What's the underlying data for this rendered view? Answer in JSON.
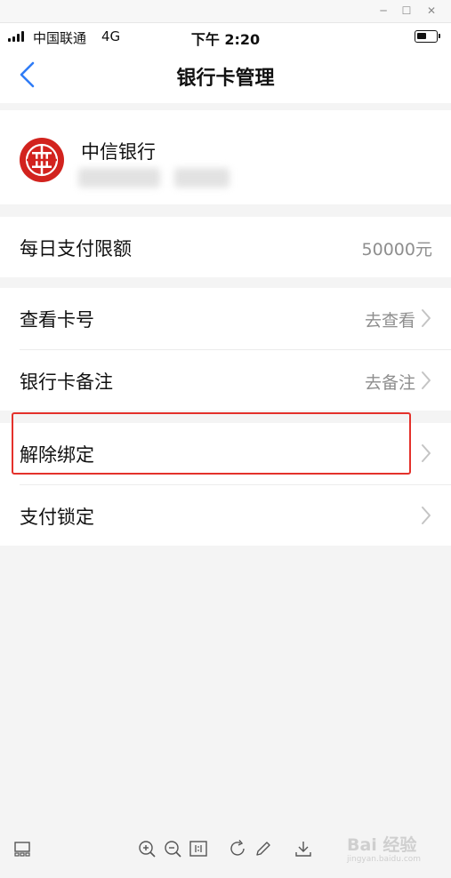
{
  "status_bar": {
    "carrier": "中国联通",
    "network": "4G",
    "time": "下午 2:20",
    "battery_level": 0.55
  },
  "nav": {
    "title": "银行卡管理"
  },
  "bank": {
    "name": "中信银行"
  },
  "limit": {
    "label": "每日支付限额",
    "value": "50000元"
  },
  "rows": {
    "view_card_number": {
      "label": "查看卡号",
      "action": "去查看"
    },
    "card_note": {
      "label": "银行卡备注",
      "action": "去备注"
    },
    "unbind": {
      "label": "解除绑定"
    },
    "payment_lock": {
      "label": "支付锁定"
    }
  },
  "watermark": {
    "text": "Bai 经验",
    "sub": "jingyan.baidu.com"
  },
  "colors": {
    "back_arrow": "#2f7cf6",
    "bank_logo_red": "#d2231e",
    "highlight_red": "#e4312b"
  }
}
